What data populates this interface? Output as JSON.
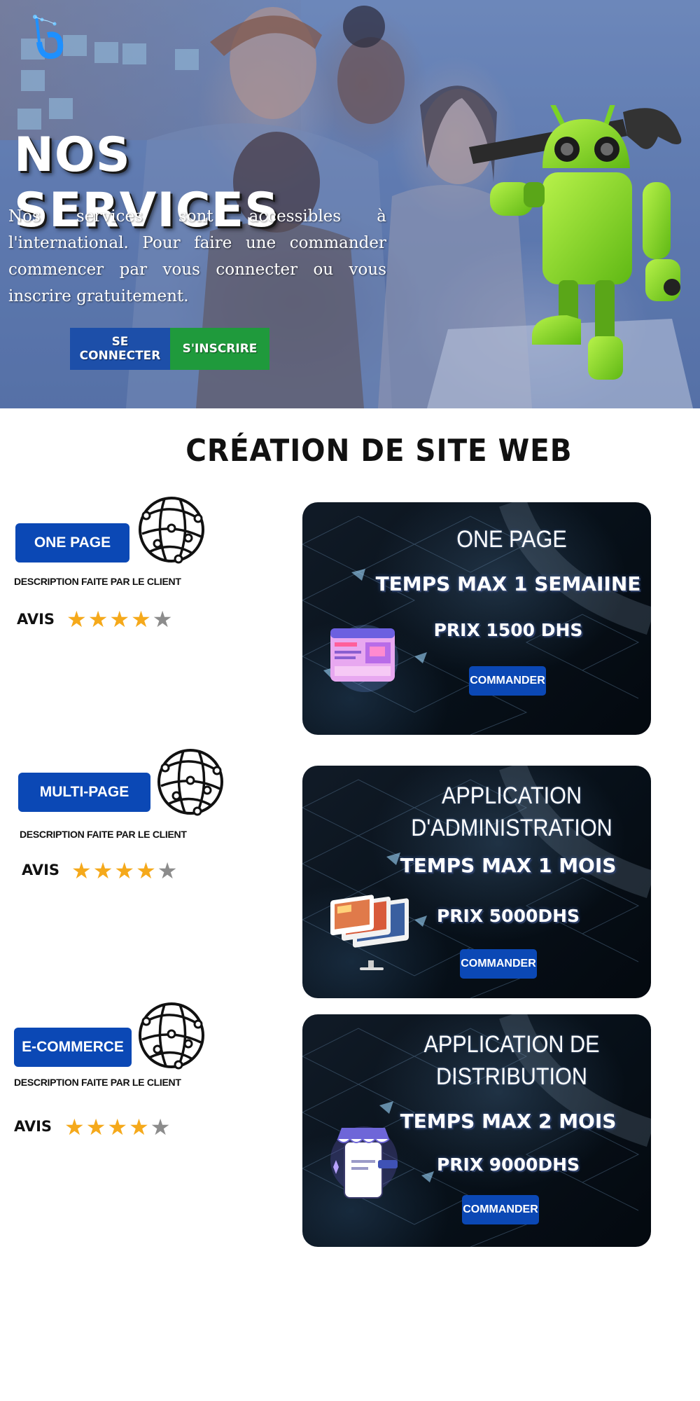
{
  "hero": {
    "title": "NOS SERVICES",
    "text": "Nos services sont accessibles à l'international. Pour faire une commander commencer par vous connecter ou vous inscrire gratuitement.",
    "login_label": "SE CONNECTER",
    "signup_label": "S'INSCRIRE",
    "colors": {
      "login": "#1d4fa9",
      "signup": "#1f9a3c"
    }
  },
  "section": {
    "title": "CRÉATION DE SITE WEB"
  },
  "services": [
    {
      "button_label": "ONE PAGE",
      "description": "DESCRIPTION FAITE PAR LE CLIENT",
      "avis_label": "AVIS",
      "rating": 4,
      "rating_max": 5,
      "card": {
        "heading": "ONE PAGE",
        "time": "TEMPS MAX 1 SEMAIINE",
        "price": "PRIX 1500 DHS",
        "order_label": "COMMANDER",
        "illustration": "website-mockup-icon"
      }
    },
    {
      "button_label": "MULTI-PAGE",
      "description": "DESCRIPTION FAITE PAR LE CLIENT",
      "avis_label": "AVIS",
      "rating": 4,
      "rating_max": 5,
      "card": {
        "heading_line1": "APPLICATION",
        "heading_line2": "D'ADMINISTRATION",
        "time": "TEMPS MAX 1 MOIS",
        "price": "PRIX 5000DHS",
        "order_label": "COMMANDER",
        "illustration": "monitor-screens-icon"
      }
    },
    {
      "button_label": "E-COMMERCE",
      "description": "DESCRIPTION FAITE PAR LE CLIENT",
      "avis_label": "AVIS",
      "rating": 4,
      "rating_max": 5,
      "card": {
        "heading_line1": "APPLICATION DE",
        "heading_line2": "DISTRIBUTION",
        "time": "TEMPS MAX 2 MOIS",
        "price": "PRIX 9000DHS",
        "order_label": "COMMANDER",
        "illustration": "mobile-shop-icon"
      }
    }
  ],
  "theme": {
    "primary": "#0b48b5",
    "star": "#f5a91b",
    "star_empty": "#8c8c8c"
  }
}
